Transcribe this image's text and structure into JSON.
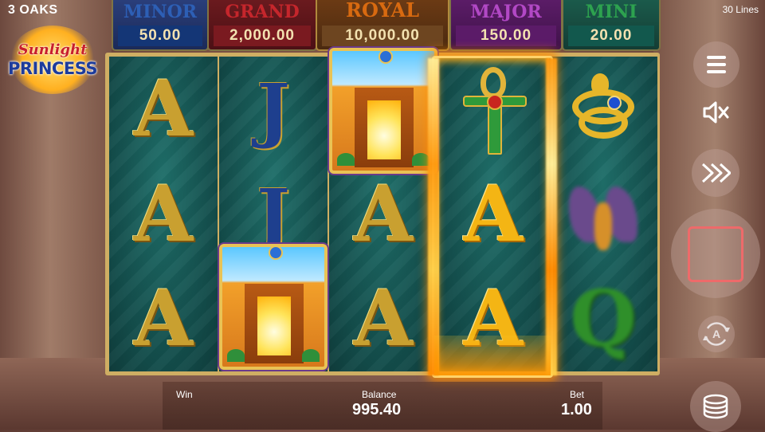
{
  "header": {
    "brand": "3 OAKS",
    "lines": "30 Lines"
  },
  "logo": {
    "line1": "Sunlight",
    "line2": "PRINCESS"
  },
  "jackpots": [
    {
      "name": "MINOR",
      "value": "50.00"
    },
    {
      "name": "GRAND",
      "value": "2,000.00"
    },
    {
      "name": "ROYAL",
      "value": "10,000.00"
    },
    {
      "name": "MAJOR",
      "value": "150.00"
    },
    {
      "name": "MINI",
      "value": "20.00"
    }
  ],
  "reels": {
    "r1": [
      "A",
      "A",
      "A"
    ],
    "r2": [
      "J",
      "J"
    ],
    "r3": [
      "A",
      "A"
    ],
    "r4": [
      "A",
      "A"
    ],
    "r5": [
      "Q"
    ]
  },
  "bottom": {
    "win_label": "Win",
    "balance_label": "Balance",
    "balance_value": "995.40",
    "bet_label": "Bet",
    "bet_value": "1.00"
  },
  "controls": {
    "autoplay_letter": "A"
  },
  "colors": {
    "reel_bg": "#134c4a",
    "accent_gold": "#c9a030",
    "spin_border": "#ee6a6a"
  }
}
